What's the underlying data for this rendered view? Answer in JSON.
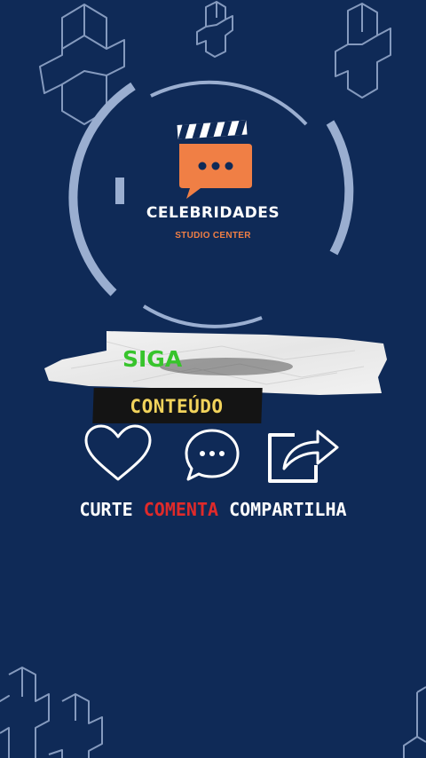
{
  "colors": {
    "background": "#0f2a57",
    "outline": "#9aaed0",
    "accent_orange": "#f07f45",
    "green": "#37c42c",
    "yellow": "#f2d35b",
    "red": "#e02a2a",
    "white": "#ffffff"
  },
  "logo": {
    "icon": "clapperboard-chat-icon",
    "title": "CELEBRIDADES",
    "subtitle": "STUDIO CENTER"
  },
  "banner": {
    "siga": "SIGA",
    "conteudo": "CONTEÚDO"
  },
  "actions": [
    {
      "icon": "heart-icon",
      "label": "CURTE"
    },
    {
      "icon": "comment-icon",
      "label": "COMENTA"
    },
    {
      "icon": "share-icon",
      "label": "COMPARTILHA"
    }
  ]
}
